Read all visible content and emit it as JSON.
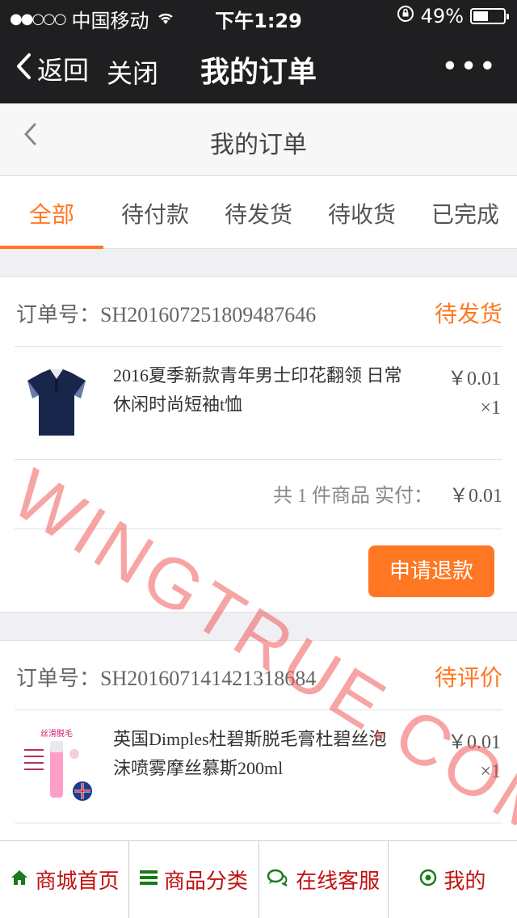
{
  "status_bar": {
    "carrier": "中国移动",
    "time": "下午1:29",
    "battery": "49%"
  },
  "wx_nav": {
    "back": "返回",
    "close": "关闭",
    "title": "我的订单",
    "more": "•••"
  },
  "page_header": {
    "title": "我的订单"
  },
  "tabs": [
    {
      "label": "全部",
      "active": true
    },
    {
      "label": "待付款"
    },
    {
      "label": "待发货"
    },
    {
      "label": "待收货"
    },
    {
      "label": "已完成"
    }
  ],
  "orders": [
    {
      "number": "订单号：SH201607251809487646",
      "status": "待发货",
      "item": {
        "name": "2016夏季新款青年男士印花翻领 日常休闲时尚短袖t恤",
        "price": "￥0.01",
        "qty": "×1"
      },
      "summary": "共 1 件商品 实付：",
      "total": "￥0.01",
      "action": "申请退款"
    },
    {
      "number": "订单号：SH201607141421318684",
      "status": "待评价",
      "item": {
        "name": "英国Dimples杜碧斯脱毛膏杜碧丝泡沫喷雾摩丝慕斯200ml",
        "price": "￥0.01",
        "qty": "×1",
        "image_text": "丝滑脱毛"
      }
    }
  ],
  "watermark": "WINGTRUE.COM",
  "bottom_nav": [
    {
      "label": "商城首页",
      "icon": "home-icon"
    },
    {
      "label": "商品分类",
      "icon": "list-icon"
    },
    {
      "label": "在线客服",
      "icon": "chat-icon"
    },
    {
      "label": "我的",
      "icon": "user-icon"
    }
  ],
  "colors": {
    "accent": "#ff7722",
    "nav_text": "#c31010",
    "nav_icon": "#1a7a1a",
    "bar": "#1f1f21"
  }
}
